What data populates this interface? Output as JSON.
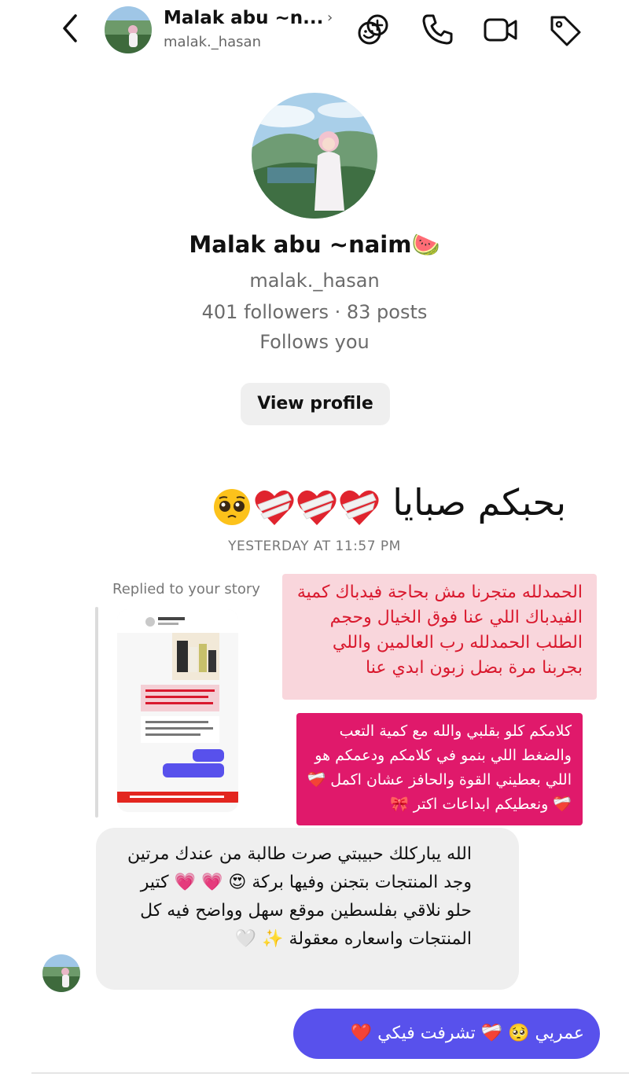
{
  "header": {
    "display_name": "Malak abu ~n...",
    "username": "malak._hasan",
    "chevron": "›",
    "icons": [
      "back-icon",
      "effects-icon",
      "phone-icon",
      "video-icon",
      "tag-icon"
    ]
  },
  "profile": {
    "name": "Malak abu ~naim🍉",
    "username": "malak._hasan",
    "stats": "401 followers · 83 posts",
    "follows": "Follows you",
    "view_profile_label": "View profile"
  },
  "messages": {
    "big_text": "بحبكم صبايا",
    "timestamp": "YESTERDAY AT 11:57 PM",
    "replied_label": "Replied to your story",
    "pink_card_text": "الحمدلله متجرنا مش بحاجة فيدباك كمية الفيدباك اللي عنا فوق الخيال وحجم الطلب الحمدلله رب العالمين واللي بجربنا مرة بضل زبون ابدي عنا",
    "magenta_card_text": "كلامكم كلو بقلبي والله مع كمية التعب والضغط اللي بنمو في كلامكم ودعمكم هو اللي بعطيني القوة والحافز عشان اكمل ❤️‍🩹❤️‍🩹 ونعطيكم ابداعات اكتر 🎀",
    "incoming_text": "الله يباركلك حبيبتي صرت طالبة من عندك مرتين وجد المنتجات بتجنن وفيها بركة 😍 💗 💗 كتير حلو نلاقي بفلسطين موقع سهل وواضح فيه كل المنتجات واسعاره معقولة ✨ 🤍",
    "outgoing_text": "عمريي 🥺 ❤️‍🩹 تشرفت فيكي ❤️"
  },
  "colors": {
    "pink_card_bg": "#f9d6dc",
    "pink_card_text": "#d9192e",
    "magenta_card_bg": "#e0196b",
    "outgoing_bubble": "#5851ec",
    "incoming_bubble": "#efefef"
  }
}
